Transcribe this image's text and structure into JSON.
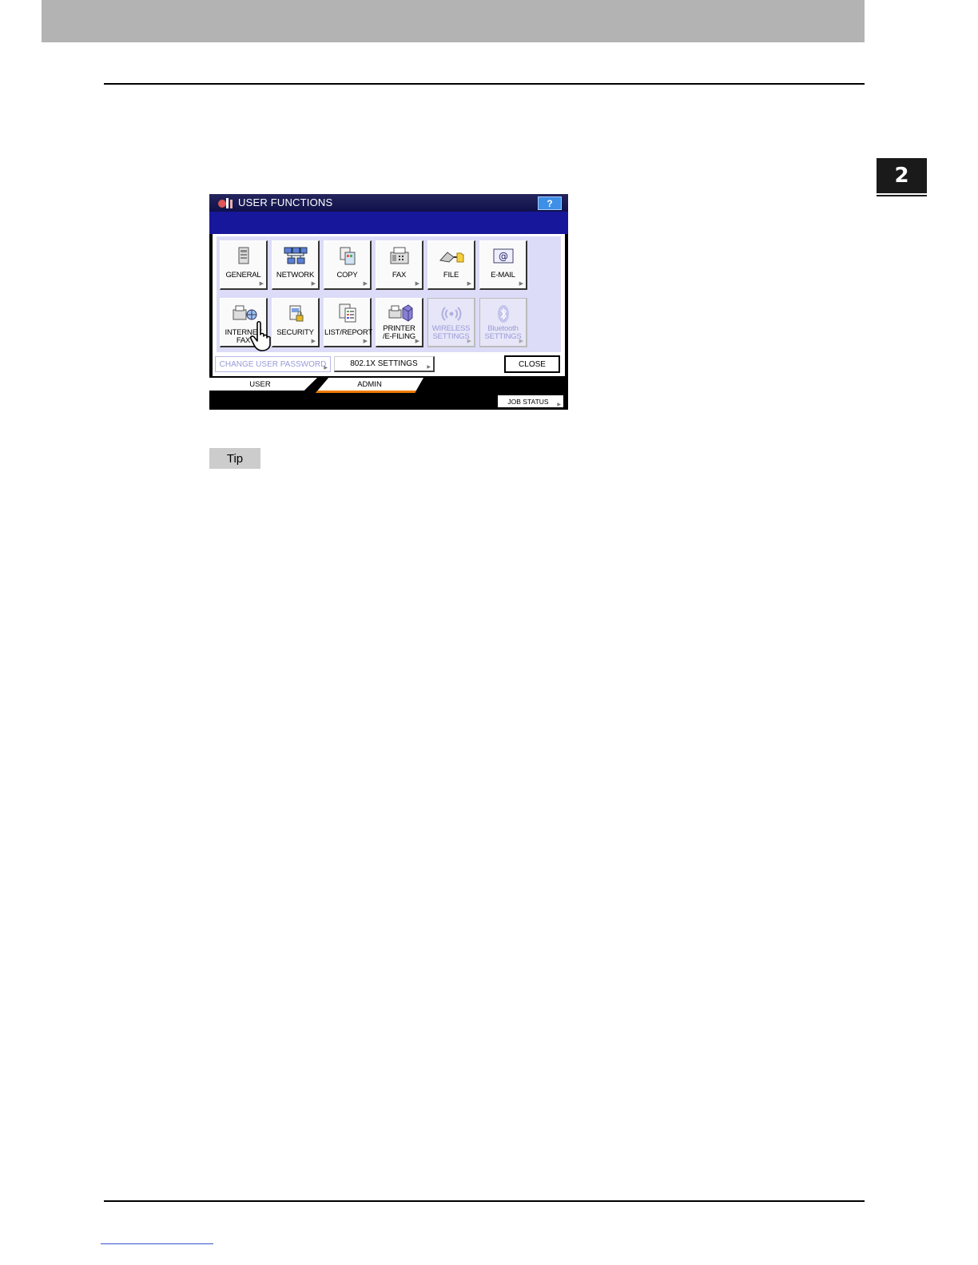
{
  "chapter": {
    "number": "2"
  },
  "screen": {
    "title": "USER FUNCTIONS",
    "help_label": "?",
    "buttons_row1": [
      "GENERAL",
      "NETWORK",
      "COPY",
      "FAX",
      "FILE",
      "E-MAIL"
    ],
    "buttons_row2": {
      "internet_fax": "INTERNET FAX",
      "security": "SECURITY",
      "list_report": "LIST/REPORT",
      "printer_line1": "PRINTER",
      "printer_line2": "/E-FILING",
      "wireless_line1": "WIRELESS",
      "wireless_line2": "SETTINGS",
      "bluetooth_line1": "Bluetooth",
      "bluetooth_line2": "SETTINGS"
    },
    "change_password_label": "CHANGE USER PASSWORD",
    "dot1x_label": "802.1X SETTINGS",
    "close_label": "CLOSE",
    "tabs": {
      "user": "USER",
      "admin": "ADMIN"
    },
    "active_tab": "ADMIN",
    "job_status_label": "JOB STATUS",
    "icons": [
      "general-icon",
      "network-icon",
      "copy-icon",
      "fax-icon",
      "file-icon",
      "email-icon",
      "internet-fax-icon",
      "security-icon",
      "list-report-icon",
      "printer-efiling-icon",
      "wireless-icon",
      "bluetooth-icon",
      "pointing-hand-icon"
    ]
  },
  "tip_label": "Tip",
  "colors": {
    "accent_tab": "#f07a00",
    "title_bar": "#10104a",
    "panel": "#dcdcf8",
    "help_button": "#3d8fe8"
  }
}
